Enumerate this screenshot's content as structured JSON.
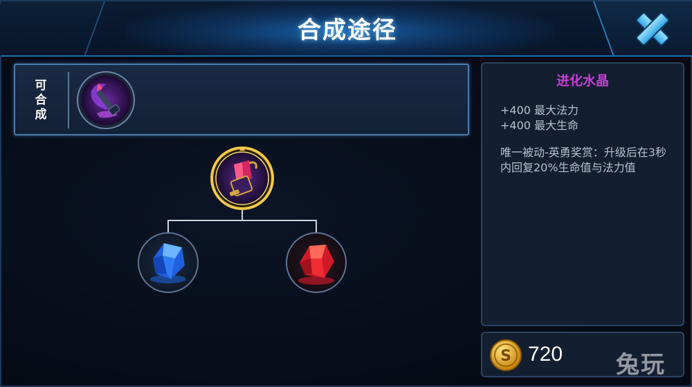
{
  "header": {
    "title": "合成途径",
    "close_icon": "close-x-icon"
  },
  "upgrade": {
    "label": "可合成",
    "item_icon": "purple-scythe-staff-icon"
  },
  "tree": {
    "top_item_icon": "evolution-crystal-icon",
    "left_item_icon": "blue-crystal-icon",
    "right_item_icon": "red-crystal-icon",
    "top_selected": true
  },
  "item": {
    "name": "进化水晶",
    "stats": [
      "+400 最大法力",
      "+400 最大生命"
    ],
    "passive": "唯一被动-英勇奖赏：升级后在3秒内回复20%生命值与法力值"
  },
  "price": {
    "coin_icon": "gold-coin-icon",
    "value": "720"
  },
  "watermark": "兔玩",
  "colors": {
    "accent": "#2a7fbf",
    "item_name": "#c63ed6",
    "selected_ring": "#f3c94a",
    "close_icon": "#4fc3f7"
  }
}
